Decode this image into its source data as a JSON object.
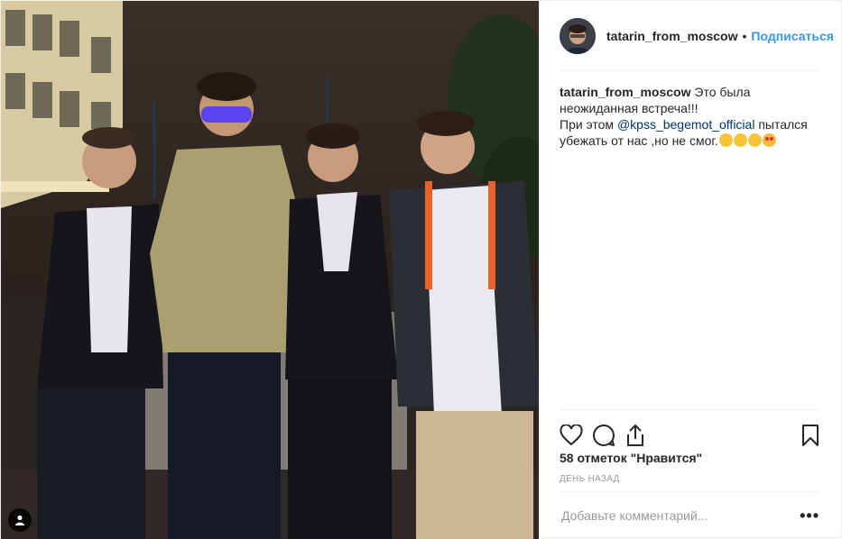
{
  "post": {
    "username": "tatarin_from_moscow",
    "separator": "•",
    "follow_label": "Подписаться",
    "caption": {
      "author": "tatarin_from_moscow",
      "line1": "Это была неожиданная встреча!!!",
      "line2_before": "При этом",
      "mention": "@kpss_begemot_official",
      "line2_after": "пытался убежать от нас ,но не смог."
    },
    "likes_text": "58 отметок \"Нравится\"",
    "time_ago": "день назад",
    "comment_placeholder": "Добавьте комментарий...",
    "more_label": "•••"
  },
  "icons": {
    "like": "heart-icon",
    "comment": "comment-bubble-icon",
    "share": "share-icon",
    "save": "bookmark-icon",
    "tagged": "person-tag-icon"
  },
  "colors": {
    "link": "#3897f0",
    "mention": "#003569",
    "text": "#262626",
    "muted": "#999999",
    "divider": "#efefef"
  }
}
